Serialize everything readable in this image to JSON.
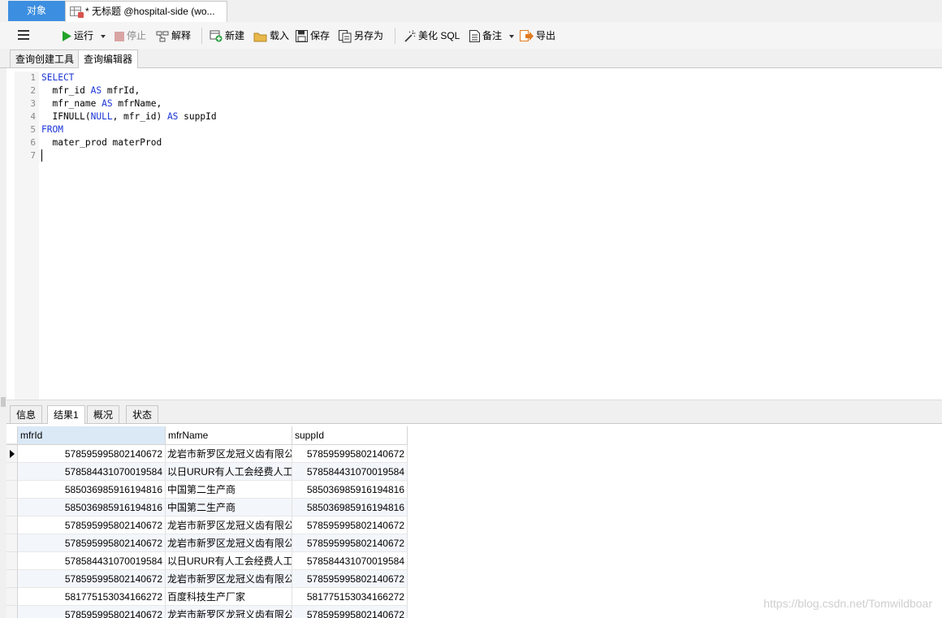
{
  "top_tabs": {
    "objects": "对象",
    "query": "* 无标题 @hospital-side (wo..."
  },
  "toolbar": {
    "run": "运行",
    "stop": "停止",
    "explain": "解释",
    "new": "新建",
    "load": "载入",
    "save": "保存",
    "save_as": "另存为",
    "beautify": "美化 SQL",
    "comment": "备注",
    "export": "导出"
  },
  "sub_tabs": {
    "builder": "查询创建工具",
    "editor": "查询编辑器"
  },
  "editor": {
    "line_numbers": [
      "1",
      "2",
      "3",
      "4",
      "5",
      "6",
      "7"
    ],
    "lines": {
      "l1_kw": "SELECT",
      "l2_a": "  mfr_id ",
      "l2_kw": "AS",
      "l2_b": " mfrId,",
      "l3_a": "  mfr_name ",
      "l3_kw": "AS",
      "l3_b": " mfrName,",
      "l4_a": "  IFNULL(",
      "l4_kw": "NULL",
      "l4_b": ", mfr_id) ",
      "l4_kw2": "AS",
      "l4_c": " suppId",
      "l5_kw": "FROM",
      "l6_a": "  mater_prod materProd"
    }
  },
  "result_tabs": {
    "info": "信息",
    "result1": "结果1",
    "overview": "概况",
    "status": "状态"
  },
  "grid": {
    "columns": [
      "mfrId",
      "mfrName",
      "suppId"
    ],
    "rows": [
      [
        "578595995802140672",
        "龙岩市新罗区龙冠义齿有限公",
        "578595995802140672"
      ],
      [
        "578584431070019584",
        "以日URUR有人工会经费人工",
        "578584431070019584"
      ],
      [
        "585036985916194816",
        "中国第二生产商",
        "585036985916194816"
      ],
      [
        "585036985916194816",
        "中国第二生产商",
        "585036985916194816"
      ],
      [
        "578595995802140672",
        "龙岩市新罗区龙冠义齿有限公",
        "578595995802140672"
      ],
      [
        "578595995802140672",
        "龙岩市新罗区龙冠义齿有限公",
        "578595995802140672"
      ],
      [
        "578584431070019584",
        "以日URUR有人工会经费人工",
        "578584431070019584"
      ],
      [
        "578595995802140672",
        "龙岩市新罗区龙冠义齿有限公",
        "578595995802140672"
      ],
      [
        "581775153034166272",
        "百度科技生产厂家",
        "581775153034166272"
      ],
      [
        "578595995802140672",
        "龙岩市新罗区龙冠义齿有限公",
        "578595995802140672"
      ]
    ]
  },
  "watermark": "https://blog.csdn.net/Tomwildboar",
  "colors": {
    "accent": "#3c8ee0",
    "keyword": "#1a34d6",
    "selected_header": "#dbe9f7"
  }
}
